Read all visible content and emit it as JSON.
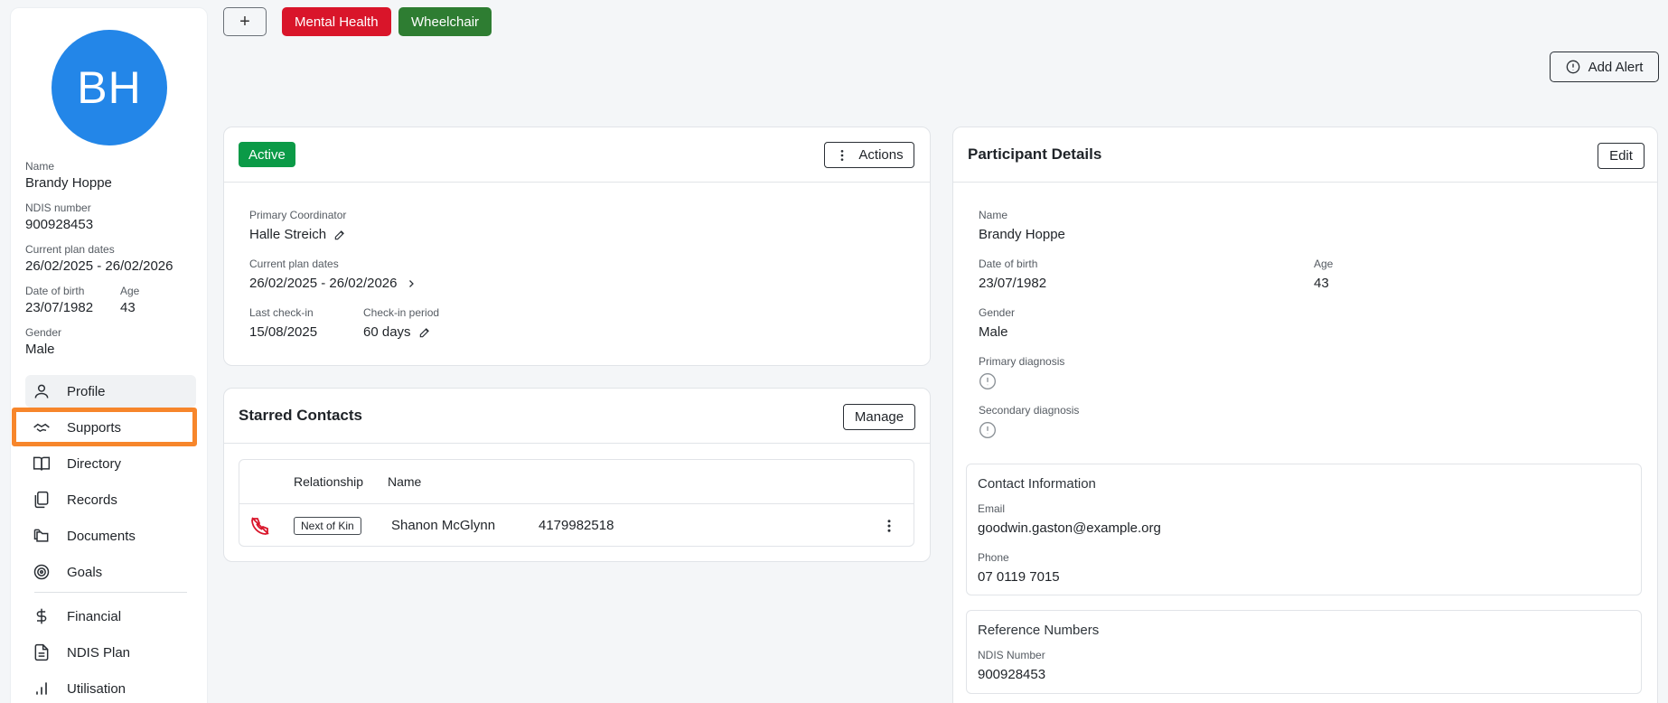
{
  "sidebar": {
    "avatar_initials": "BH",
    "avatar_color": "#2386e8",
    "name_label": "Name",
    "name": "Brandy Hoppe",
    "ndis_label": "NDIS number",
    "ndis": "900928453",
    "plan_label": "Current plan dates",
    "plan": "26/02/2025 - 26/02/2026",
    "dob_label": "Date of birth",
    "dob": "23/07/1982",
    "age_label": "Age",
    "age": "43",
    "gender_label": "Gender",
    "gender": "Male",
    "nav": [
      {
        "label": "Profile",
        "icon": "user-icon",
        "selected": true
      },
      {
        "label": "Supports",
        "icon": "handshake-icon",
        "highlighted": true
      },
      {
        "label": "Directory",
        "icon": "book-icon"
      },
      {
        "label": "Records",
        "icon": "files-icon"
      },
      {
        "label": "Documents",
        "icon": "folders-icon"
      },
      {
        "label": "Goals",
        "icon": "target-icon"
      },
      {
        "label": "Financial",
        "icon": "dollar-icon"
      },
      {
        "label": "NDIS Plan",
        "icon": "document-icon"
      },
      {
        "label": "Utilisation",
        "icon": "bar-chart-icon"
      }
    ]
  },
  "top": {
    "add_label": "+",
    "tags": [
      {
        "label": "Mental Health",
        "color": "#d9152a"
      },
      {
        "label": "Wheelchair",
        "color": "#2e7d32"
      }
    ],
    "add_alert_label": "Add Alert"
  },
  "status_card": {
    "status": "Active",
    "status_color": "#0b9a47",
    "actions_label": "Actions",
    "coordinator_label": "Primary Coordinator",
    "coordinator": "Halle Streich",
    "plan_label": "Current plan dates",
    "plan": "26/02/2025 - 26/02/2026",
    "last_checkin_label": "Last check-in",
    "last_checkin": "15/08/2025",
    "period_label": "Check-in period",
    "period": "60 days"
  },
  "contacts_card": {
    "title": "Starred Contacts",
    "manage_label": "Manage",
    "columns": [
      "Relationship",
      "Name"
    ],
    "rows": [
      {
        "relationship": "Next of Kin",
        "name": "Shanon McGlynn",
        "phone": "4179982518"
      }
    ]
  },
  "details_card": {
    "title": "Participant Details",
    "edit_label": "Edit",
    "name_label": "Name",
    "name": "Brandy Hoppe",
    "dob_label": "Date of birth",
    "dob": "23/07/1982",
    "age_label": "Age",
    "age": "43",
    "gender_label": "Gender",
    "gender": "Male",
    "primary_dx_label": "Primary diagnosis",
    "secondary_dx_label": "Secondary diagnosis",
    "contact": {
      "title": "Contact Information",
      "email_label": "Email",
      "email": "goodwin.gaston@example.org",
      "phone_label": "Phone",
      "phone": "07 0119 7015"
    },
    "reference": {
      "title": "Reference Numbers",
      "ndis_label": "NDIS Number",
      "ndis": "900928453"
    }
  }
}
